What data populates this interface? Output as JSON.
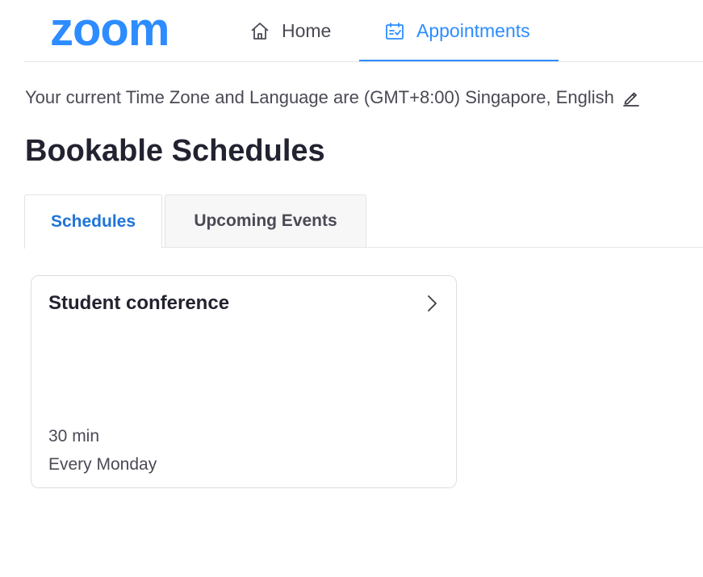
{
  "header": {
    "logo_text": "zoom",
    "nav": {
      "home_label": "Home",
      "home_icon": "home-icon",
      "appointments_label": "Appointments",
      "appointments_icon": "calendar-check-icon",
      "active": "Appointments"
    }
  },
  "timezone": {
    "text": "Your current Time Zone and Language are (GMT+8:00) Singapore, English",
    "edit_icon": "pencil-icon"
  },
  "page": {
    "title": "Bookable Schedules"
  },
  "tabs": [
    {
      "label": "Schedules",
      "active": true
    },
    {
      "label": "Upcoming Events",
      "active": false
    }
  ],
  "schedules": [
    {
      "title": "Student conference",
      "duration": "30 min",
      "recurrence": "Every Monday",
      "chevron_icon": "chevron-right-icon"
    }
  ],
  "colors": {
    "brand": "#2d8cff",
    "active_tab_text": "#1f74d6",
    "text_primary": "#222230",
    "text_secondary": "#4a4a55"
  }
}
